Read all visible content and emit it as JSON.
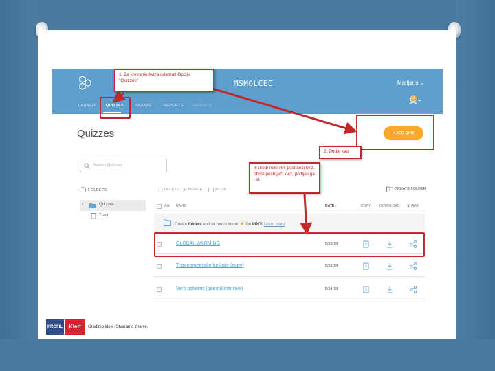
{
  "app": {
    "name": "MSMOLCEC",
    "user": "Marijana ⌄",
    "badge": "0"
  },
  "nav": [
    "LAUNCH",
    "QUIZZES",
    "ROOMS",
    "REPORTS",
    "RESULTS"
  ],
  "page": {
    "title": "Quizzes",
    "add_quiz": "+ ADD QUIZ"
  },
  "search": {
    "placeholder": "Search Quizzes"
  },
  "sidebar": {
    "header": "FOLDERS",
    "items": [
      "Quizzes",
      "Trash"
    ]
  },
  "toolbar": {
    "delete": "DELETE",
    "merge": "MERGE",
    "move": "MOVE",
    "create_folder": "CREATE FOLDER"
  },
  "table": {
    "headers": [
      "ALL",
      "NAME",
      "DATE ↓",
      "COPY",
      "DOWNLOAD",
      "SHARE"
    ],
    "promo": {
      "pre": "Create ",
      "bold": "folders",
      "post": " and so much more!",
      "go": "Go ",
      "pro": "PRO!",
      "link": "Learn More"
    },
    "rows": [
      {
        "name": "GLOBAL WARMING",
        "date": "5/28/18"
      },
      {
        "name": "Trigonometrijske funkcije (copy)",
        "date": "5/28/18"
      },
      {
        "name": "Verb patterns (gerund/infinitive)",
        "date": "5/24/18"
      }
    ]
  },
  "annotations": {
    "a1": "1. Za kreiranje kviza odabrati Opciju \"Quizzes\"",
    "a2": "2. Dodaj kviz",
    "a3": "Ili uredi neki već postojeći kviz, obriši postojeći kviz, podijeli ga i sl."
  },
  "footer": {
    "profil": "PROFIL",
    "klett": "Klett",
    "tagline": "Gradimo ideje. Stvaramo znanje."
  },
  "colors": {
    "accent_blue": "#5e9fce",
    "orange": "#f6a92b",
    "annotation_red": "#c0282a",
    "frame": "#48799e"
  }
}
